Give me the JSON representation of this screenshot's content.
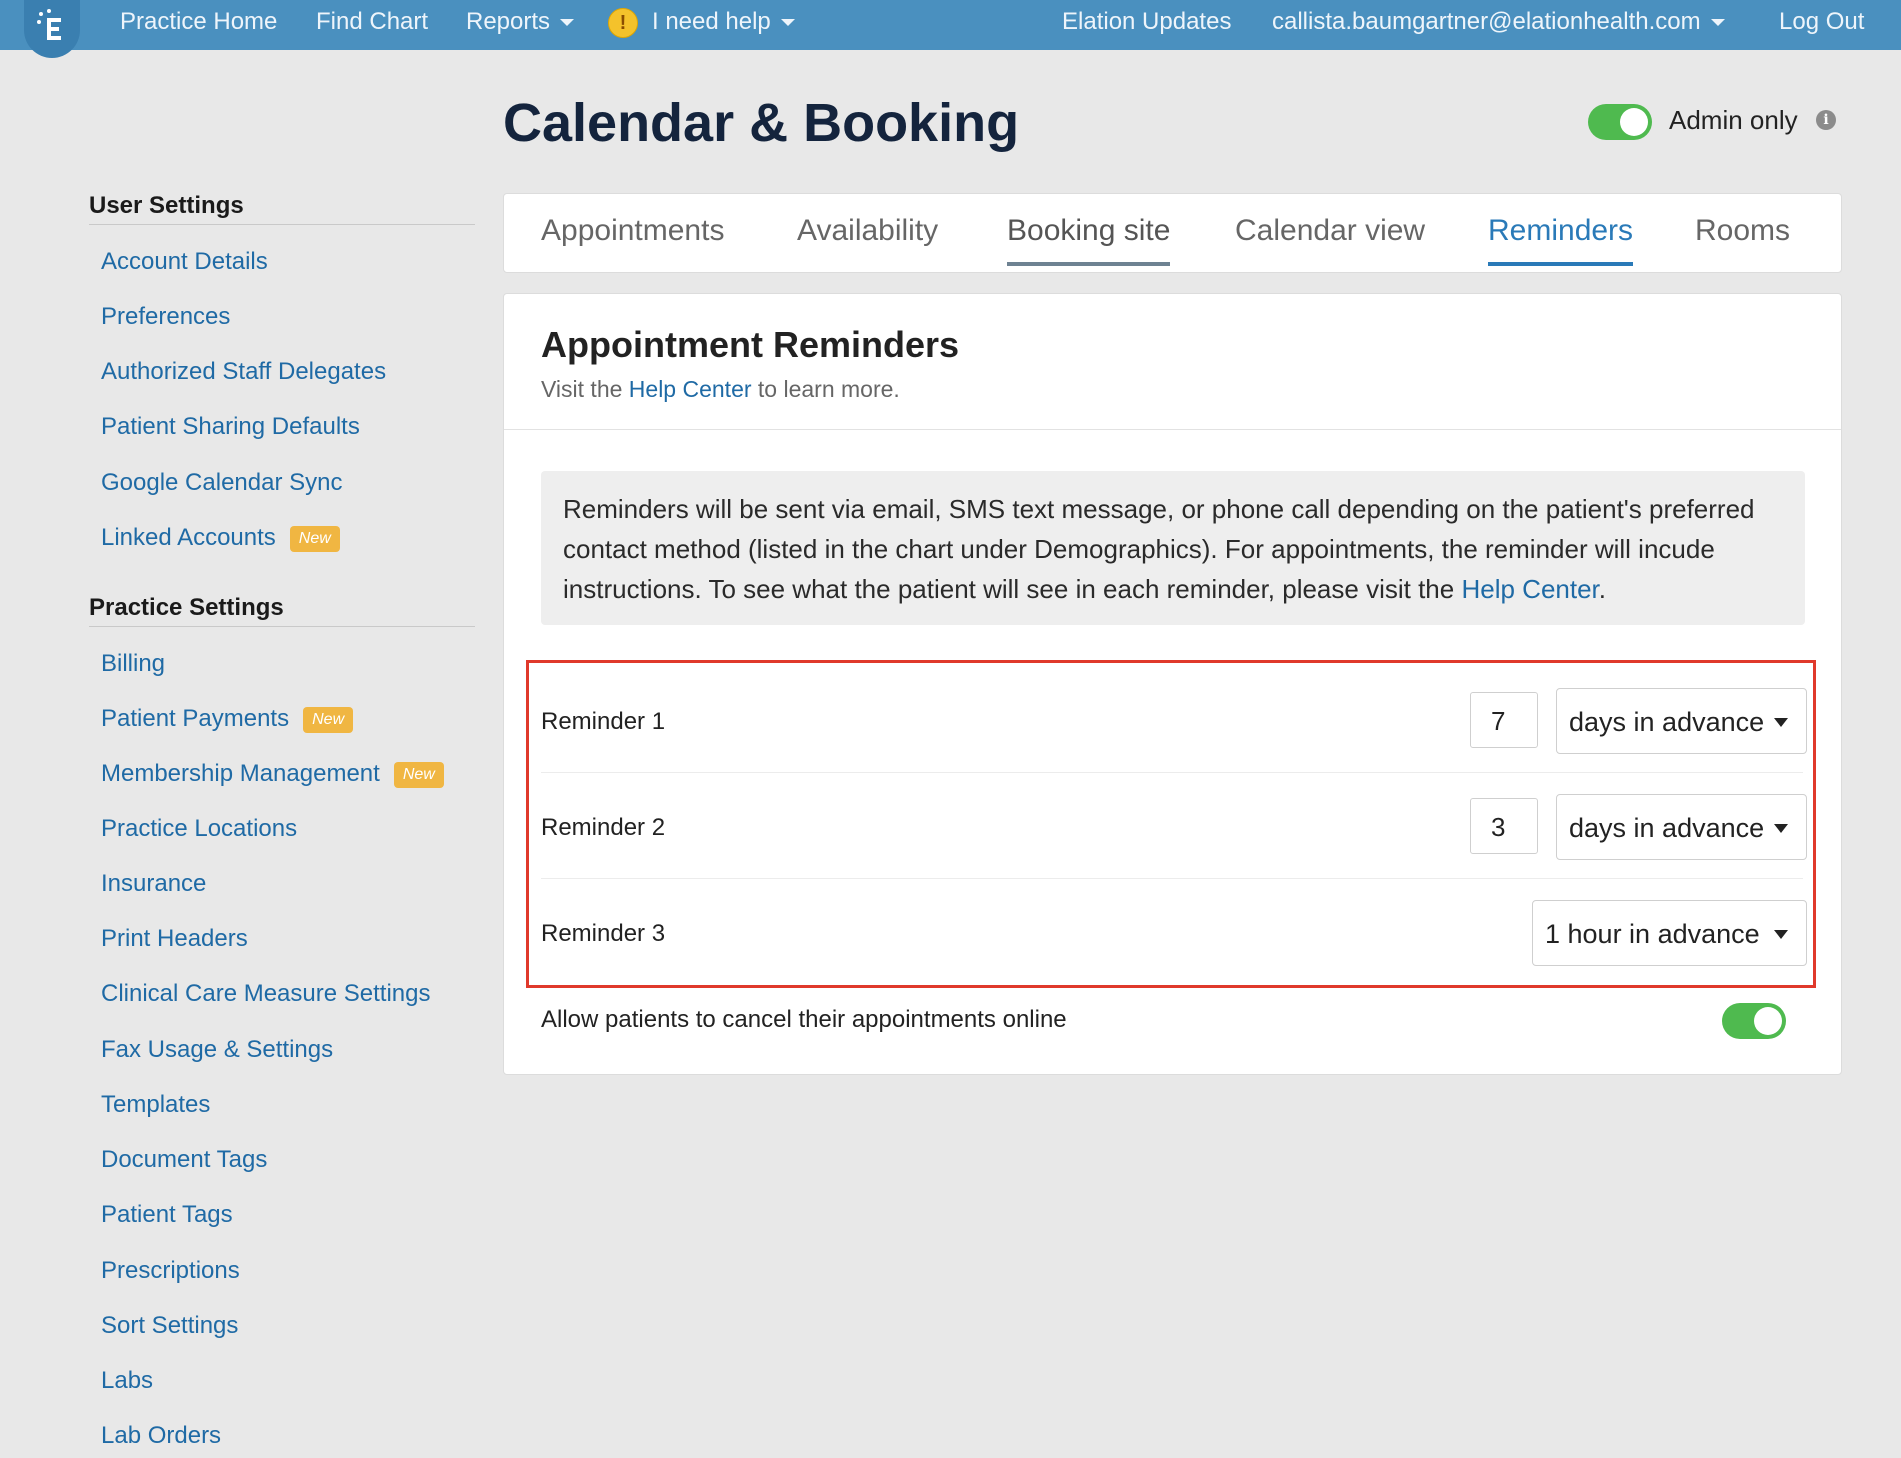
{
  "topnav": {
    "practice_home": "Practice Home",
    "find_chart": "Find Chart",
    "reports": "Reports",
    "help": "I need help",
    "updates": "Elation Updates",
    "user_email": "callista.baumgartner@elationhealth.com",
    "logout": "Log Out"
  },
  "header": {
    "title": "Calendar & Booking",
    "admin_only_label": "Admin only",
    "admin_only_on": true
  },
  "sidebar": {
    "user_settings_heading": "User Settings",
    "user_items": [
      {
        "label": "Account Details"
      },
      {
        "label": "Preferences"
      },
      {
        "label": "Authorized Staff Delegates"
      },
      {
        "label": "Patient Sharing Defaults"
      },
      {
        "label": "Google Calendar Sync"
      },
      {
        "label": "Linked Accounts",
        "badge": "New"
      }
    ],
    "practice_settings_heading": "Practice Settings",
    "practice_items": [
      {
        "label": "Billing"
      },
      {
        "label": "Patient Payments",
        "badge": "New"
      },
      {
        "label": "Membership Management",
        "badge": "New"
      },
      {
        "label": "Practice Locations"
      },
      {
        "label": "Insurance"
      },
      {
        "label": "Print Headers"
      },
      {
        "label": "Clinical Care Measure Settings"
      },
      {
        "label": "Fax Usage & Settings"
      },
      {
        "label": "Templates"
      },
      {
        "label": "Document Tags"
      },
      {
        "label": "Patient Tags"
      },
      {
        "label": "Prescriptions"
      },
      {
        "label": "Sort Settings"
      },
      {
        "label": "Labs"
      },
      {
        "label": "Lab Orders"
      }
    ]
  },
  "tabs": [
    {
      "label": "Appointments"
    },
    {
      "label": "Availability"
    },
    {
      "label": "Booking site"
    },
    {
      "label": "Calendar view"
    },
    {
      "label": "Reminders",
      "active": true
    },
    {
      "label": "Rooms"
    }
  ],
  "card": {
    "title": "Appointment Reminders",
    "sub_prefix": "Visit the",
    "sub_link": "Help Center",
    "sub_suffix": "to learn more.",
    "notice_text": "Reminders will be sent via email, SMS text message, or phone call depending on the patient's preferred contact method (listed in the chart under Demographics). For appointments, the reminder will incude instructions. To see what the patient will see in each reminder, please visit the",
    "notice_link": "Help Center",
    "notice_end": ".",
    "reminders": [
      {
        "label": "Reminder 1",
        "value": "7",
        "unit": "days in advance"
      },
      {
        "label": "Reminder 2",
        "value": "3",
        "unit": "days in advance"
      },
      {
        "label": "Reminder 3",
        "unit": "1 hour in advance"
      }
    ],
    "cancel_label": "Allow patients to cancel their appointments online",
    "cancel_enabled": true
  },
  "colors": {
    "nav_bg": "#4a90bf",
    "link": "#1f6aa5",
    "active_tab": "#2a7ab8",
    "toggle_on": "#4fba4f",
    "highlight": "#e0392b",
    "badge": "#f0b642"
  }
}
